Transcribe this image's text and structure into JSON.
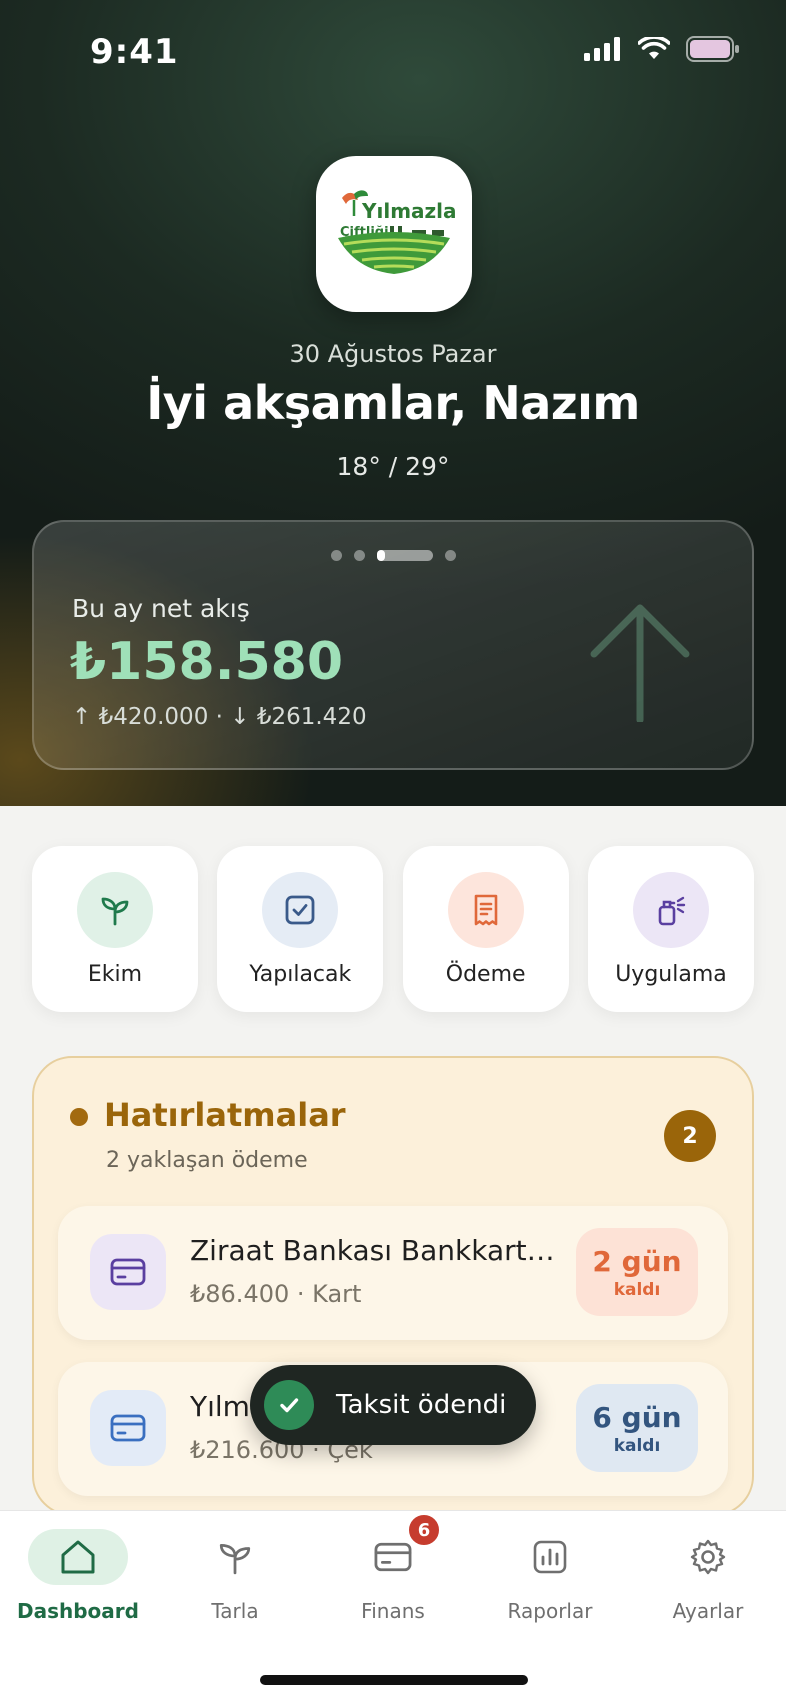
{
  "status_bar": {
    "time": "9:41"
  },
  "header": {
    "logo_alt": "Yılmazlar Çiftliği",
    "logo_text_line1": "Yılmazlar",
    "logo_text_line2": "Çiftliği",
    "date": "30 Ağustos Pazar",
    "greeting": "İyi akşamlar, Nazım",
    "weather": "18° / 29°"
  },
  "flow_card": {
    "label": "Bu ay net akış",
    "amount": "₺158.580",
    "sub": "↑ ₺420.000 · ↓ ₺261.420",
    "page_count": 4,
    "active_page": 3
  },
  "quick_actions": [
    {
      "label": "Ekim",
      "icon": "sprout-icon",
      "color": "#1f7a4c",
      "bg": "#e0f1e7"
    },
    {
      "label": "Yapılacak",
      "icon": "checkbox-icon",
      "color": "#3a5a8a",
      "bg": "#e5ecf5"
    },
    {
      "label": "Ödeme",
      "icon": "receipt-icon",
      "color": "#e0683a",
      "bg": "#fde5dc"
    },
    {
      "label": "Uygulama",
      "icon": "sprayer-icon",
      "color": "#5a3fa0",
      "bg": "#ece6f6"
    }
  ],
  "reminders": {
    "title": "Hatırlatmalar",
    "subtitle": "2 yaklaşan ödeme",
    "count": "2",
    "items": [
      {
        "name": "Ziraat Bankası Bankkart B...",
        "meta": "₺86.400 · Kart",
        "days": "2 gün",
        "days_label": "kaldı",
        "icon": "card-icon",
        "icon_color": "#5a3fa0",
        "icon_bg": "#ece6f6",
        "badge_color": "#e0683a",
        "badge_bg": "#fde2d6"
      },
      {
        "name": "Yılmazlar Tarım Çek",
        "meta": "₺216.600 · Çek",
        "days": "6 gün",
        "days_label": "kaldı",
        "icon": "card-icon",
        "icon_color": "#3a6fc0",
        "icon_bg": "#e3ebf7",
        "badge_color": "#33557f",
        "badge_bg": "#dfe8f2"
      }
    ]
  },
  "toast": {
    "text": "Taksit ödendi"
  },
  "tabbar": {
    "tabs": [
      {
        "label": "Dashboard",
        "icon": "home-icon",
        "active": true
      },
      {
        "label": "Tarla",
        "icon": "sprout-icon",
        "active": false
      },
      {
        "label": "Finans",
        "icon": "card-icon",
        "active": false,
        "badge": "6"
      },
      {
        "label": "Raporlar",
        "icon": "chart-icon",
        "active": false
      },
      {
        "label": "Ayarlar",
        "icon": "gear-icon",
        "active": false
      }
    ]
  }
}
